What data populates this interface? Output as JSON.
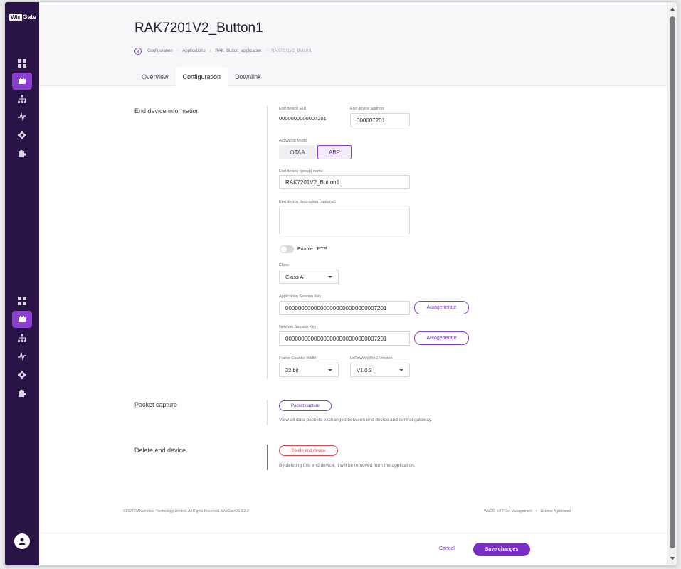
{
  "app": {
    "logo_text": "Gate",
    "logo_box": "Wis"
  },
  "sidebar": {
    "top_items": [
      {
        "icon": "dashboard-icon"
      },
      {
        "icon": "device-icon",
        "active": true
      },
      {
        "icon": "network-icon"
      },
      {
        "icon": "activity-icon"
      },
      {
        "icon": "gear-icon"
      },
      {
        "icon": "puzzle-icon"
      }
    ],
    "bottom_items": [
      {
        "icon": "dashboard-icon"
      },
      {
        "icon": "device-icon",
        "active": true
      },
      {
        "icon": "network-icon"
      },
      {
        "icon": "activity-icon"
      },
      {
        "icon": "gear-icon"
      },
      {
        "icon": "puzzle-icon"
      }
    ]
  },
  "header": {
    "title": "RAK7201V2_Button1",
    "breadcrumb": [
      "Configuration",
      "Applications",
      "RAK_Button_application",
      "RAK7201V2_Button1"
    ],
    "tabs": [
      "Overview",
      "Configuration",
      "Downlink"
    ],
    "active_tab": "Configuration"
  },
  "device_info": {
    "section_label": "End device information",
    "eui_label": "End device EUI",
    "eui_value": "0000000000007201",
    "address_label": "End device address",
    "address_value": "000007201",
    "activation_label": "Activation Mode",
    "activation_options": [
      "OTAA",
      "ABP"
    ],
    "activation_selected": "ABP",
    "name_label": "End device (group) name",
    "name_value": "RAK7201V2_Button1",
    "description_label": "End device description (optional)",
    "description_value": "",
    "lptp_label": "Enable LPTP",
    "lptp_enabled": false,
    "class_label": "Class",
    "class_value": "Class A",
    "app_key_label": "Application Session Key",
    "app_key_value": "00000000000000000000000000007201",
    "app_key_button": "Autogenerate",
    "net_key_label": "Network Session Key",
    "net_key_value": "00000000000000000000000000007201",
    "net_key_button": "Autogenerate",
    "fcnt_label": "Frame Counter Width",
    "fcnt_value": "32 bit",
    "mac_label": "LoRaWAN MAC Version",
    "mac_value": "V1.0.3"
  },
  "packet_capture": {
    "section_label": "Packet capture",
    "button_label": "Packet capture",
    "description": "View all data packets exchanged between end device and central gateway."
  },
  "delete_device": {
    "section_label": "Delete end device",
    "button_label": "Delete end device",
    "description": "By deleting this end device, it will be removed from the application."
  },
  "footer": {
    "copyright": "©2024 RAKwireless Technology Limited. All Rights Reserved. WisGateOS 2.2.8",
    "link1": "WisDM IoT Fleet Management",
    "separator": "•",
    "link2": "Licence Agreement"
  },
  "actions": {
    "cancel_label": "Cancel",
    "save_label": "Save changes"
  },
  "colors": {
    "sidebar_bg": "#2a1347",
    "accent": "#8b3fd1",
    "danger": "#e0464d"
  }
}
